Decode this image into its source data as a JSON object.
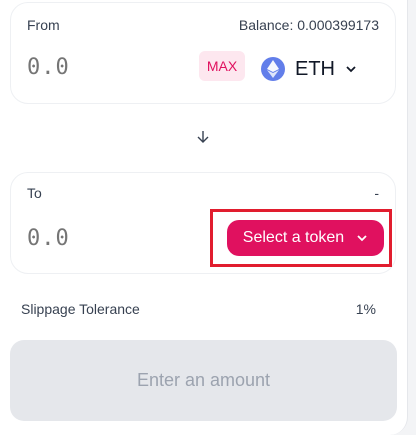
{
  "from": {
    "label": "From",
    "balance": "Balance: 0.000399173",
    "amount_placeholder": "0.0",
    "max_label": "MAX",
    "token": {
      "symbol": "ETH",
      "icon": "ethereum-icon",
      "color": "#627eea"
    }
  },
  "to": {
    "label": "To",
    "balance": "-",
    "amount_placeholder": "0.0",
    "select_label": "Select a token"
  },
  "slippage": {
    "label": "Slippage Tolerance",
    "value": "1%"
  },
  "action": {
    "label": "Enter an amount"
  },
  "colors": {
    "accent": "#e0115f",
    "highlight": "#e11d2e",
    "disabled": "#e5e7eb"
  }
}
